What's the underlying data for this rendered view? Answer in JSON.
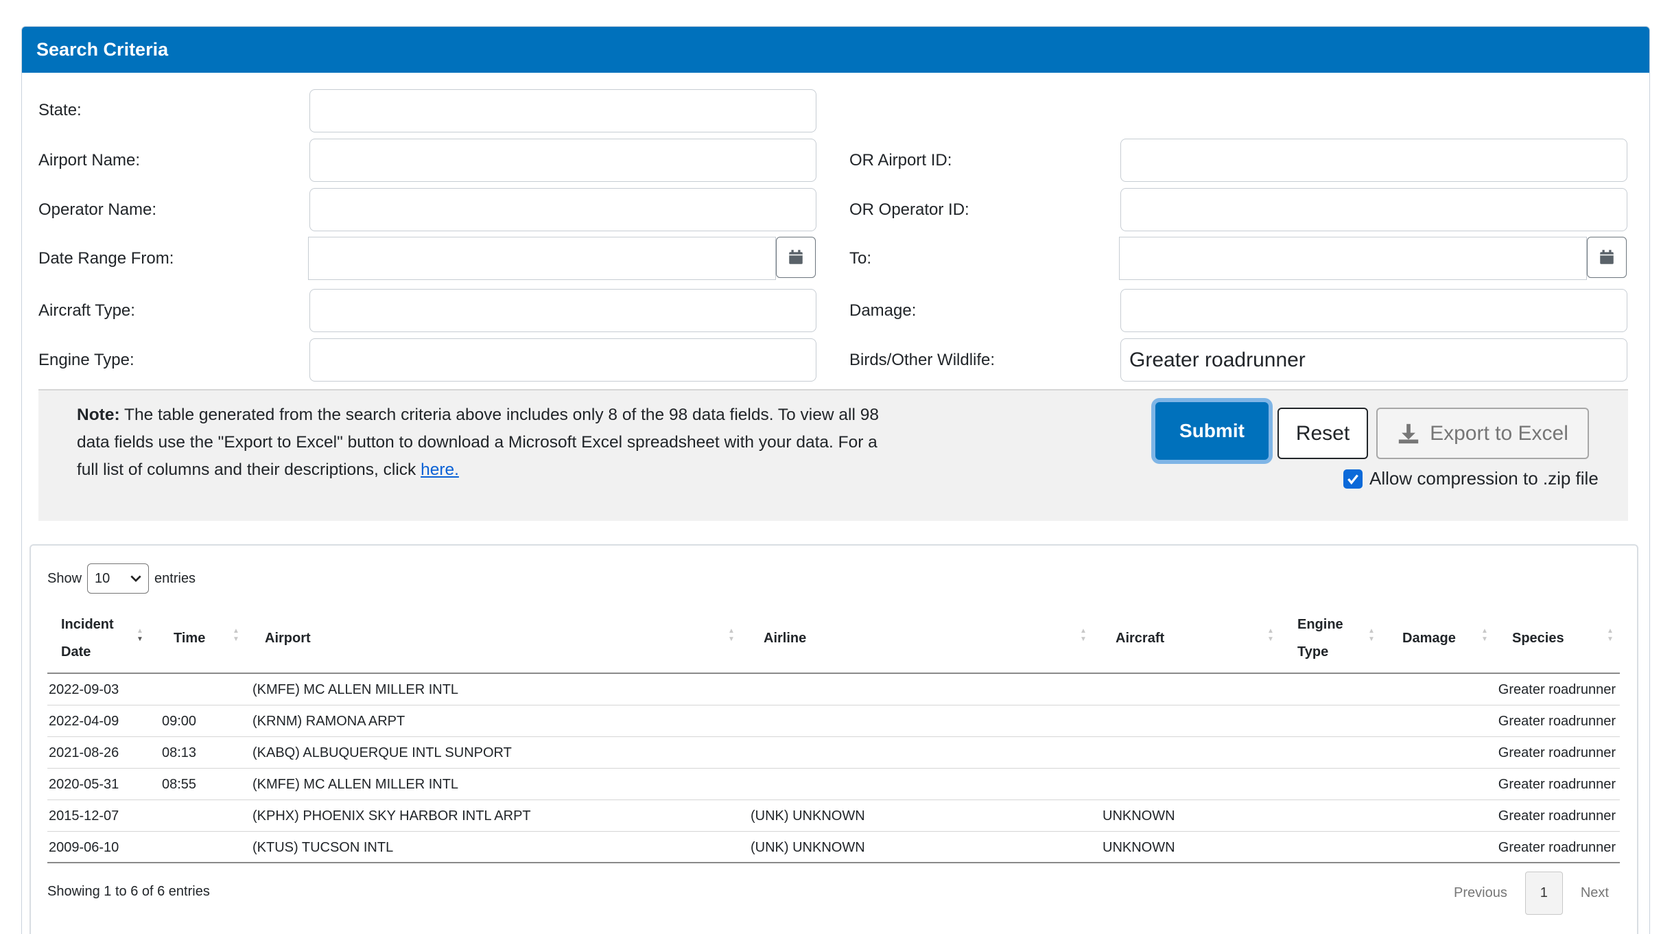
{
  "header": {
    "title": "Search Criteria"
  },
  "form": {
    "state_label": "State:",
    "state_value": "",
    "airport_name_label": "Airport Name:",
    "airport_name_value": "",
    "airport_id_label": "OR Airport ID:",
    "airport_id_value": "",
    "operator_name_label": "Operator Name:",
    "operator_name_value": "",
    "operator_id_label": "OR Operator ID:",
    "operator_id_value": "",
    "date_from_label": "Date Range From:",
    "date_from_value": "",
    "date_to_label": "To:",
    "date_to_value": "",
    "aircraft_type_label": "Aircraft Type:",
    "aircraft_type_value": "",
    "damage_label": "Damage:",
    "damage_value": "",
    "engine_type_label": "Engine Type:",
    "engine_type_value": "",
    "wildlife_label": "Birds/Other Wildlife:",
    "wildlife_value": "Greater roadrunner"
  },
  "note": {
    "bold": "Note:",
    "text": " The table generated from the search criteria above includes only 8 of the 98 data fields. To view all 98 data fields use the \"Export to Excel\" button to download a Microsoft Excel spreadsheet with your data. For a full list of columns and their descriptions, click ",
    "link": "here."
  },
  "buttons": {
    "submit": "Submit",
    "reset": "Reset",
    "export": "Export to Excel",
    "zip_label": "Allow compression to .zip file",
    "zip_checked": true
  },
  "table": {
    "length_show": "Show",
    "length_value": "10",
    "length_entries": "entries",
    "headers": {
      "incident_date_1": "Incident",
      "incident_date_2": "Date",
      "time": "Time",
      "airport": "Airport",
      "airline": "Airline",
      "aircraft": "Aircraft",
      "engine_type_1": "Engine",
      "engine_type_2": "Type",
      "damage": "Damage",
      "species": "Species"
    },
    "rows": [
      {
        "date": "2022-09-03",
        "time": "",
        "airport": "(KMFE) MC ALLEN MILLER INTL",
        "airline": "",
        "aircraft": "",
        "species": "Greater roadrunner"
      },
      {
        "date": "2022-04-09",
        "time": "09:00",
        "airport": "(KRNM) RAMONA ARPT",
        "airline": "",
        "aircraft": "",
        "species": "Greater roadrunner"
      },
      {
        "date": "2021-08-26",
        "time": "08:13",
        "airport": "(KABQ) ALBUQUERQUE INTL SUNPORT",
        "airline": "",
        "aircraft": "",
        "species": "Greater roadrunner"
      },
      {
        "date": "2020-05-31",
        "time": "08:55",
        "airport": "(KMFE) MC ALLEN MILLER INTL",
        "airline": "",
        "aircraft": "",
        "species": "Greater roadrunner"
      },
      {
        "date": "2015-12-07",
        "time": "",
        "airport": "(KPHX) PHOENIX SKY HARBOR INTL ARPT",
        "airline": "(UNK) UNKNOWN",
        "aircraft": "UNKNOWN",
        "species": "Greater roadrunner"
      },
      {
        "date": "2009-06-10",
        "time": "",
        "airport": "(KTUS) TUCSON INTL",
        "airline": "(UNK) UNKNOWN",
        "aircraft": "UNKNOWN",
        "species": "Greater roadrunner"
      }
    ],
    "info": "Showing 1 to 6 of 6 entries",
    "pager": {
      "previous": "Previous",
      "current": "1",
      "next": "Next"
    }
  },
  "colors": {
    "header_bg": "#0071bc",
    "link": "#0b62d6",
    "checkbox": "#0b6ad9"
  }
}
